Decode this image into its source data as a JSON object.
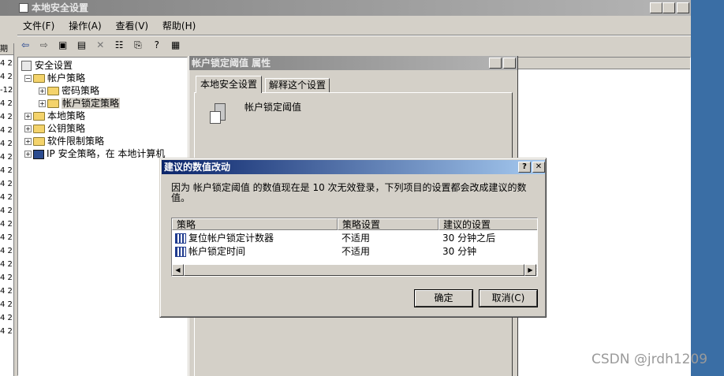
{
  "main_window": {
    "title": "本地安全设置",
    "menu": [
      "文件(F)",
      "操作(A)",
      "查看(V)",
      "帮助(H)"
    ],
    "left_column_header": "期",
    "gutter_lines": [
      "4 2",
      "4 2",
      "-12",
      "4 2",
      "4 2",
      "4 2",
      "4 2",
      "4 2",
      "4 2",
      "4 2",
      "4 2",
      "4 2",
      "4 2",
      "4 2",
      "4 2",
      "4 2",
      "4 2",
      "4 2",
      "4 2",
      "4 2",
      "4 2"
    ]
  },
  "tree": {
    "root": "安全设置",
    "account_policies": "帐户策略",
    "password_policy": "密码策略",
    "lockout_policy": "帐户锁定策略",
    "local_policies": "本地策略",
    "public_key_policies": "公钥策略",
    "software_restriction": "软件限制策略",
    "ip_security": "IP 安全策略，在 本地计算机"
  },
  "properties_dialog": {
    "title": "帐户锁定阈值 属性",
    "tab_local": "本地安全设置",
    "tab_explain": "解释这个设置",
    "setting_name": "帐户锁定阈值",
    "help_btn": "?",
    "close_btn": "✕"
  },
  "suggest_dialog": {
    "title": "建议的数值改动",
    "message": "因为 帐户锁定阈值 的数值现在是 10 次无效登录，下列项目的设置都会改成建议的数值。",
    "columns": [
      "策略",
      "策略设置",
      "建议的设置"
    ],
    "rows": [
      {
        "policy": "复位帐户锁定计数器",
        "setting": "不适用",
        "suggested": "30 分钟之后"
      },
      {
        "policy": "帐户锁定时间",
        "setting": "不适用",
        "suggested": "30 分钟"
      }
    ],
    "ok_label": "确定",
    "cancel_label": "取消(C)",
    "help_btn": "?",
    "close_btn": "✕"
  },
  "watermark": "CSDN @jrdh1209"
}
